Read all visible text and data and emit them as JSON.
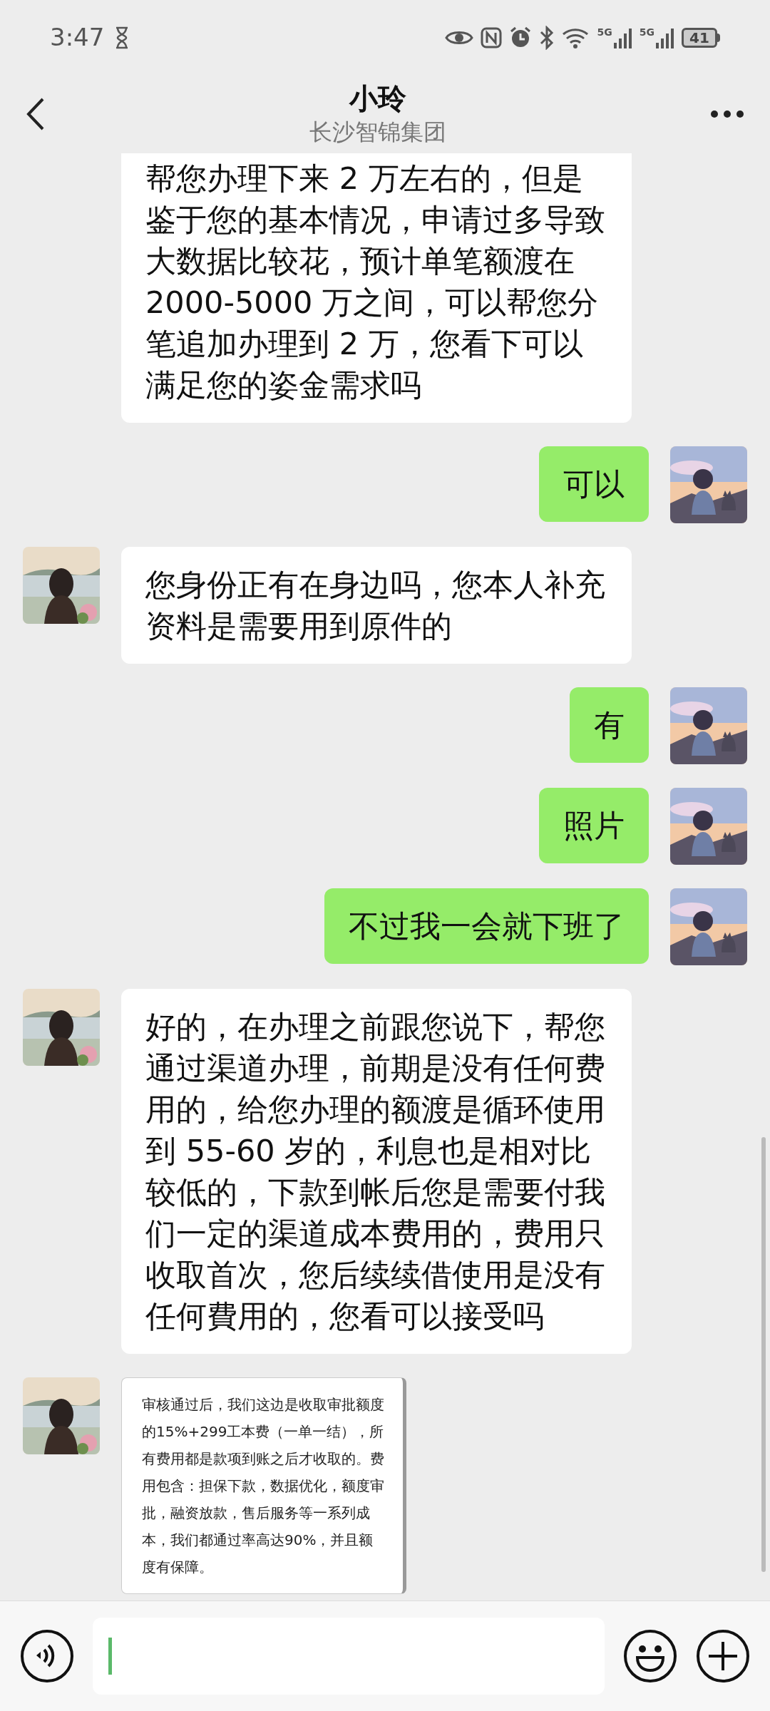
{
  "status_bar": {
    "time": "3:47",
    "network_labels": [
      "5G",
      "5G"
    ],
    "battery": "41"
  },
  "header": {
    "title": "小玲",
    "subtitle": "长沙智锦集团"
  },
  "messages": [
    {
      "from_me": false,
      "kind": "text",
      "cut_top": true,
      "text": "帮您办理下来 2 万左右的，但是鉴于您的基本情况，申请过多导致大数据比较花，预计单笔额渡在 2000-5000 万之间，可以帮您分笔追加办理到 2 万，您看下可以满足您的姿金需求吗"
    },
    {
      "from_me": true,
      "kind": "text",
      "cut_top": false,
      "text": "可以"
    },
    {
      "from_me": false,
      "kind": "text",
      "cut_top": false,
      "text": "您身份正有在身边吗，您本人补充资料是需要用到原件的"
    },
    {
      "from_me": true,
      "kind": "text",
      "cut_top": false,
      "text": "有"
    },
    {
      "from_me": true,
      "kind": "text",
      "cut_top": false,
      "text": "照片"
    },
    {
      "from_me": true,
      "kind": "text",
      "cut_top": false,
      "text": "不过我一会就下班了"
    },
    {
      "from_me": false,
      "kind": "text",
      "cut_top": false,
      "text": "好的，在办理之前跟您说下，帮您通过渠道办理，前期是没有任何费用的，给您办理的额渡是循环使用到 55-60 岁的，利息也是相对比较低的，下款到帐后您是需要付我们一定的渠道成本费用的，费用只收取首次，您后续续借使用是没有任何費用的，您看可以接受吗"
    },
    {
      "from_me": false,
      "kind": "image_text",
      "cut_top": false,
      "text": "审核通过后，我们这边是收取审批额度的15%+299工本费（一单一结），所有费用都是款项到账之后才收取的。费用包含：担保下款，数据优化，额度审批，融资放款，售后服务等一系列成本，我们都通过率高达90%，并且额度有保障。"
    }
  ]
}
